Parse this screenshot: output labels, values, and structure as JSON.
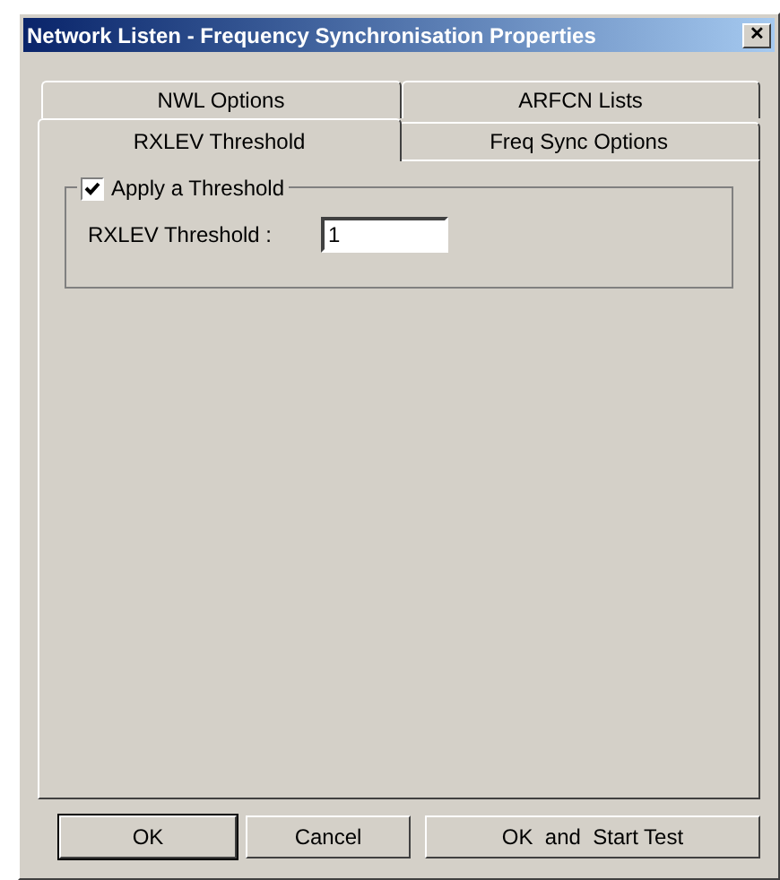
{
  "window": {
    "title": "Network Listen - Frequency Synchronisation Properties",
    "close": "✕"
  },
  "tab_rows": [
    [
      {
        "label": "NWL Options",
        "selected": false
      },
      {
        "label": "ARFCN Lists",
        "selected": false
      }
    ],
    [
      {
        "label": "RXLEV Threshold",
        "selected": true
      },
      {
        "label": "Freq Sync Options",
        "selected": false
      }
    ]
  ],
  "group": {
    "label": "Apply a Threshold",
    "checked": true,
    "field_label": "RXLEV Threshold :",
    "value": "1"
  },
  "buttons": [
    {
      "label": "OK",
      "default": true
    },
    {
      "label": "Cancel",
      "default": false
    },
    {
      "label": "OK  and  Start Test",
      "default": false
    }
  ]
}
